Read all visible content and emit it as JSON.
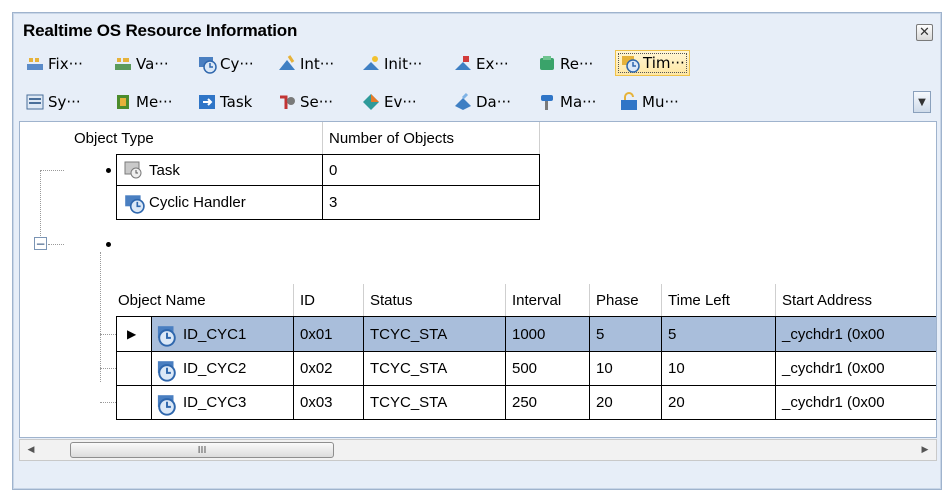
{
  "window": {
    "title": "Realtime OS Resource Information",
    "close_glyph": "✕"
  },
  "toolbar": {
    "row1": [
      {
        "label": "Fix···",
        "icon": "fixed-pool-icon"
      },
      {
        "label": "Va···",
        "icon": "variable-pool-icon"
      },
      {
        "label": "Cy···",
        "icon": "cyclic-handler-icon"
      },
      {
        "label": "Int···",
        "icon": "interrupt-icon"
      },
      {
        "label": "Init···",
        "icon": "init-routine-icon"
      },
      {
        "label": "Ex···",
        "icon": "exception-icon"
      },
      {
        "label": "Re···",
        "icon": "ready-queue-icon"
      },
      {
        "label": "Tim···",
        "icon": "timer-icon",
        "active": true
      }
    ],
    "row2": [
      {
        "label": "Sy···",
        "icon": "system-icon"
      },
      {
        "label": "Me···",
        "icon": "memory-icon"
      },
      {
        "label": "Task",
        "icon": "task-icon"
      },
      {
        "label": "Se···",
        "icon": "semaphore-icon"
      },
      {
        "label": "Ev···",
        "icon": "eventflag-icon"
      },
      {
        "label": "Da···",
        "icon": "dataqueue-icon"
      },
      {
        "label": "Ma···",
        "icon": "mailbox-icon"
      },
      {
        "label": "Mu···",
        "icon": "mutex-icon"
      }
    ],
    "overflow_glyph": "▼"
  },
  "summary": {
    "headers": [
      "Object Type",
      "Number of Objects"
    ],
    "rows": [
      {
        "type": "Task",
        "count": "0",
        "icon": "task-icon"
      },
      {
        "type": "Cyclic Handler",
        "count": "3",
        "icon": "cyclic-handler-icon"
      }
    ]
  },
  "detail": {
    "headers": [
      "Object Name",
      "ID",
      "Status",
      "Interval",
      "Phase",
      "Time Left",
      "Start Address"
    ],
    "rows": [
      {
        "name": "ID_CYC1",
        "id": "0x01",
        "status": "TCYC_STA",
        "interval": "1000",
        "phase": "5",
        "time_left": "5",
        "start": "_cychdr1 (0x00",
        "selected": true
      },
      {
        "name": "ID_CYC2",
        "id": "0x02",
        "status": "TCYC_STA",
        "interval": "500",
        "phase": "10",
        "time_left": "10",
        "start": "_cychdr1 (0x00",
        "selected": false
      },
      {
        "name": "ID_CYC3",
        "id": "0x03",
        "status": "TCYC_STA",
        "interval": "250",
        "phase": "20",
        "time_left": "20",
        "start": "_cychdr1 (0x00",
        "selected": false
      }
    ]
  },
  "tree": {
    "collapse_glyph": "−",
    "row_pointer": "▶"
  },
  "scrollbar": {
    "left": "◀",
    "right": "▶",
    "thumb_grip": "III"
  },
  "colors": {
    "selection": "#a9bedb",
    "panel": "#e7eef8",
    "border": "#9fb3cd"
  }
}
